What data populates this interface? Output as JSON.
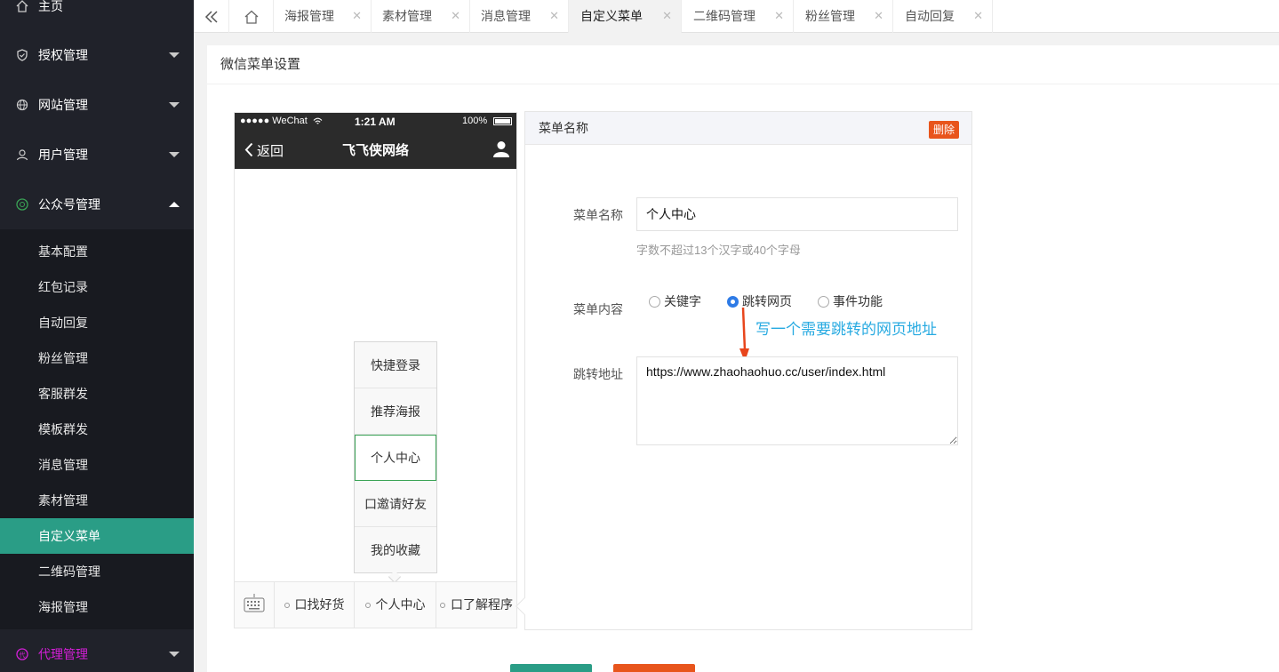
{
  "sidebar": {
    "home": "主页",
    "items": [
      {
        "label": "授权管理",
        "icon": "shield-icon"
      },
      {
        "label": "网站管理",
        "icon": "globe-icon"
      },
      {
        "label": "用户管理",
        "icon": "user-icon"
      },
      {
        "label": "公众号管理",
        "icon": "wechat-icon"
      }
    ],
    "sub_items": [
      "基本配置",
      "红包记录",
      "自动回复",
      "粉丝管理",
      "客服群发",
      "模板群发",
      "消息管理",
      "素材管理",
      "自定义菜单",
      "二维码管理",
      "海报管理"
    ],
    "active_sub": "自定义菜单",
    "agent": "代理管理",
    "colors": {
      "bg": "#20222a",
      "active": "#2a9d86",
      "agent": "#d41fd8"
    }
  },
  "tabs": [
    "海报管理",
    "素材管理",
    "消息管理",
    "自定义菜单",
    "二维码管理",
    "粉丝管理",
    "自动回复"
  ],
  "active_tab": "自定义菜单",
  "page": {
    "title": "微信菜单设置"
  },
  "phone": {
    "signal": "●●●●● WeChat",
    "time": "1:21 AM",
    "battery": "100%",
    "back": "返回",
    "title": "飞飞侠网络",
    "submenu": [
      "快捷登录",
      "推荐海报",
      "个人中心",
      "口邀请好友",
      "我的收藏"
    ],
    "submenu_selected": "个人中心",
    "bottom_menu": [
      "口找好货",
      "个人中心",
      "口了解程序"
    ]
  },
  "editor": {
    "header": "菜单名称",
    "delete": "删除",
    "name_label": "菜单名称",
    "name_value": "个人中心",
    "name_hint": "字数不超过13个汉字或40个字母",
    "content_label": "菜单内容",
    "options": [
      "关键字",
      "跳转网页",
      "事件功能"
    ],
    "selected_option": "跳转网页",
    "annotation": "写一个需要跳转的网页地址",
    "url_label": "跳转地址",
    "url_value": "https://www.zhaohaohuo.cc/user/index.html"
  }
}
